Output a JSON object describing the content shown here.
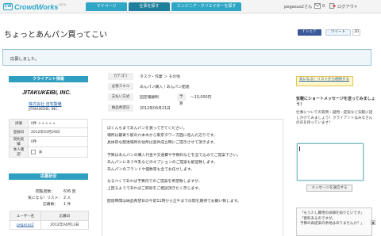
{
  "header": {
    "logo_mark": "CW",
    "logo_text": "CrowdWorks",
    "logo_beta": "BETA",
    "tabs": [
      "マイページ",
      "仕事を探す",
      "エンジニア・クリエイターを探す"
    ],
    "user": "pegasus2さん",
    "inbox_count": "0",
    "logout": "ログアウト"
  },
  "page": {
    "title": "ちょっとあんパン買ってこい",
    "fb_share": "f シェア",
    "tweet": "ツイート",
    "tweet_count": "20"
  },
  "notice": "応募しました。",
  "client": {
    "heading": "クライアント情報",
    "logo_text": "JITAKUKEIBI, INC.",
    "name": "株式会社 自宅警備",
    "name_en": "JITAKUKEIBI, INC.",
    "rows": [
      {
        "label": "評価",
        "value": "0件",
        "stars": "★★★★★"
      },
      {
        "label": "登録日",
        "value": "2012年03月29日"
      },
      {
        "label": "契約実績",
        "value": "0件"
      },
      {
        "label": "本人確認",
        "value": "済"
      }
    ]
  },
  "applicants": {
    "heading": "応募状況",
    "viewed_label": "閲覧回数：",
    "viewed": "636 回",
    "watch_label": "気になる！リスト：",
    "watch": "2 人",
    "apps_label": "応募数：",
    "apps": "1 件",
    "table_headers": [
      "ユーザー名",
      "応募日"
    ],
    "rows": [
      {
        "user": "pegasus2",
        "date": "2012年04月13日"
      }
    ]
  },
  "job": {
    "category_label": "カテゴリ",
    "category": "タスク・作業 ＞ その他",
    "skills_label": "必要スキル",
    "skills": "あんパン購入 / あんパン配達",
    "pay_label": "支払い方式",
    "pay_type": "固定報酬制",
    "budget_label": "予算",
    "budget": "〜10,000円",
    "deadline_label": "納品希望日",
    "deadline": "2012年04月21日",
    "description": [
      "ぼくんちまであんパンを買ってきてください。",
      "場所は最寄り駅の六本木から東京タワー方面に進んだ辺りです。",
      "具体的な配達場所の住所は案件成立時にご提示させて頂きます。",
      "",
      "予算はあんパンの購入代金や交通費や手数料などを全て込みでご提案下さい。",
      "あんパンにあう牛乳などのオプションのご提案も歓迎致します。",
      "あんパンのブランドや個数等も全てお任せします。",
      "",
      "なるべくであれば予算内でのご提案を希望致しますが、",
      "上回るようであればご辞退をご相談頂きたく存じます。",
      "",
      "配達時間は納品希望日の午前11時から正午までの間を期待でお願い致します。"
    ]
  },
  "sidebar": {
    "watch_button": "気になる！リストから削除する",
    "msg_title": "気軽にショートメッセージを送ってみましょう！",
    "msg_text": "仕事についての質問・疑問・提案など気軽に話しかけてみましょう！クライアントはみなさんの声を待っています！",
    "send_button": "メッセージを送信する",
    "sample": [
      "「もう少し費用の詳細を知りたいです」",
      "「資料あるのですが。",
      "予算の再提案の余地はありませんか？」"
    ]
  }
}
